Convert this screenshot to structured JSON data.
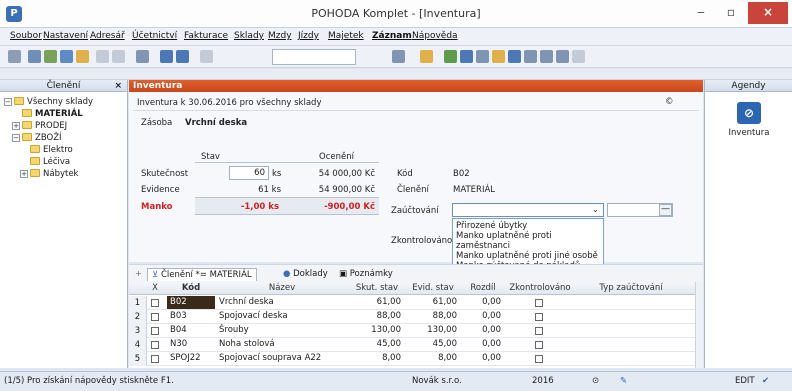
{
  "window": {
    "title": "POHODA Komplet - [Inventura]",
    "app_icon_glyph": "P"
  },
  "menu": [
    "Soubor",
    "Nastavení",
    "Adresář",
    "Účetnictví",
    "Fakturace",
    "Sklady",
    "Mzdy",
    "Jízdy",
    "Majetek",
    "Záznam",
    "Nápověda"
  ],
  "left_panel": {
    "title": "Členění",
    "close_glyph": "×",
    "tree": [
      {
        "label": "Všechny sklady",
        "level": 0,
        "expander": "−"
      },
      {
        "label": "MATERIÁL",
        "level": 1,
        "expander": "",
        "bold": true
      },
      {
        "label": "PRODEJ",
        "level": 1,
        "expander": "+"
      },
      {
        "label": "ZBOŽÍ",
        "level": 1,
        "expander": "−"
      },
      {
        "label": "Elektro",
        "level": 2,
        "expander": ""
      },
      {
        "label": "Léčiva",
        "level": 2,
        "expander": ""
      },
      {
        "label": "Nábytek",
        "level": 2,
        "expander": "+"
      }
    ]
  },
  "form": {
    "header": "Inventura",
    "subtitle": "Inventura k 30.06.2016 pro všechny sklady",
    "copyright": "©",
    "zasoba_label": "Zásoba",
    "zasoba_value": "Vrchní deska",
    "col_stav": "Stav",
    "col_oceneni": "Ocenění",
    "skutecnost_label": "Skutečnost",
    "skutecnost_value": "60",
    "skutecnost_unit": "ks",
    "skutecnost_price": "54 000,00 Kč",
    "evidence_label": "Evidence",
    "evidence_value": "61 ks",
    "evidence_price": "54 900,00 Kč",
    "manko_label": "Manko",
    "manko_value": "-1,00 ks",
    "manko_price": "-900,00 Kč",
    "kod_label": "Kód",
    "kod_value": "B02",
    "cleneni_label": "Členění",
    "cleneni_value": "MATERIÁL",
    "zauctovani_label": "Zaúčtování",
    "zauctovani_value": "",
    "zkontrolovano_label": "Zkontrolováno",
    "dropdown_options": [
      "Přirozené úbytky",
      "Manko uplatněné proti zaměstnanci",
      "Manko uplatněné proti jiné osobě",
      "Manko zúčtované do nákladů"
    ]
  },
  "tabs": [
    {
      "label": "Členění *= MATERIÁL",
      "icon": "filter-icon"
    },
    {
      "label": "Doklady",
      "icon": "doc-icon"
    },
    {
      "label": "Poznámky",
      "icon": "note-icon"
    }
  ],
  "grid": {
    "headers": [
      "X",
      "Kód",
      "Název",
      "Skut. stav",
      "Evid. stav",
      "Rozdíl",
      "Zkontrolováno",
      "Typ zaúčtování"
    ],
    "rows": [
      {
        "n": "1",
        "kod": "B02",
        "nazev": "Vrchní deska",
        "skut": "61,00",
        "evid": "61,00",
        "rozdil": "0,00"
      },
      {
        "n": "2",
        "kod": "B03",
        "nazev": "Spojovací deska",
        "skut": "88,00",
        "evid": "88,00",
        "rozdil": "0,00"
      },
      {
        "n": "3",
        "kod": "B04",
        "nazev": "Šrouby",
        "skut": "130,00",
        "evid": "130,00",
        "rozdil": "0,00"
      },
      {
        "n": "4",
        "kod": "N30",
        "nazev": "Noha stolová",
        "skut": "45,00",
        "evid": "45,00",
        "rozdil": "0,00"
      },
      {
        "n": "5",
        "kod": "SPOJ22",
        "nazev": "Spojovací souprava A22",
        "skut": "8,00",
        "evid": "8,00",
        "rozdil": "0,00"
      }
    ]
  },
  "agenda": {
    "title": "Agendy",
    "item": "Inventura"
  },
  "status": {
    "help": "(1/5) Pro získání nápovědy stiskněte F1.",
    "company": "Novák s.r.o.",
    "year": "2016",
    "mode": "EDIT"
  },
  "colors": {
    "accent": "#d4521f",
    "manko": "#d02020",
    "selected": "#3a2a1a"
  }
}
